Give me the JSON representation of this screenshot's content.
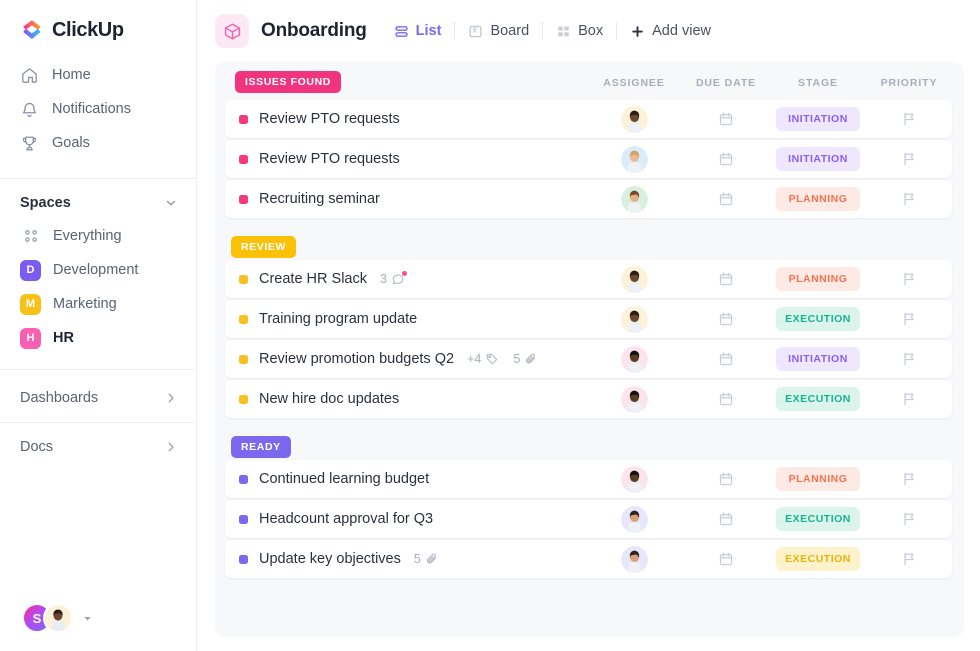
{
  "brand": {
    "name": "ClickUp"
  },
  "sidebar": {
    "nav": [
      {
        "label": "Home",
        "icon": "home-icon"
      },
      {
        "label": "Notifications",
        "icon": "bell-icon"
      },
      {
        "label": "Goals",
        "icon": "trophy-icon"
      }
    ],
    "spaces_title": "Spaces",
    "spaces": [
      {
        "label": "Everything",
        "icon": "grid-icon",
        "initial": "",
        "color": "",
        "active": false
      },
      {
        "label": "Development",
        "icon": "space-badge",
        "initial": "D",
        "color": "#7b5cf0",
        "active": false
      },
      {
        "label": "Marketing",
        "icon": "space-badge",
        "initial": "M",
        "color": "#f7c116",
        "active": false
      },
      {
        "label": "HR",
        "icon": "space-badge",
        "initial": "H",
        "color": "#f85fb0",
        "active": true
      }
    ],
    "links": [
      {
        "label": "Dashboards"
      },
      {
        "label": "Docs"
      }
    ],
    "footer": {
      "workspace_initial": "S"
    }
  },
  "header": {
    "title": "Onboarding",
    "views": [
      {
        "label": "List",
        "icon": "list-icon",
        "active": true
      },
      {
        "label": "Board",
        "icon": "board-icon",
        "active": false
      },
      {
        "label": "Box",
        "icon": "box-icon",
        "active": false
      },
      {
        "label": "Add view",
        "icon": "plus-icon",
        "active": false
      }
    ]
  },
  "columns": {
    "assignee": "ASSIGNEE",
    "due_date": "DUE DATE",
    "stage": "STAGE",
    "priority": "PRIORITY"
  },
  "groups": [
    {
      "badge": "ISSUES FOUND",
      "badge_bg": "#f0357e",
      "dot_color": "#f5397f",
      "tasks": [
        {
          "title": "Review PTO requests",
          "stage": "INITIATION",
          "stage_fg": "#8b5cf6",
          "stage_bg": "#efe7fe",
          "avatar_bg": "#fdf2d9",
          "avatar_skin": "#6b4630",
          "avatar_hair": "#2b1c14",
          "comments": "",
          "tags": "",
          "files": ""
        },
        {
          "title": "Review PTO requests",
          "stage": "INITIATION",
          "stage_fg": "#8b5cf6",
          "stage_bg": "#efe7fe",
          "avatar_bg": "#d9ecfb",
          "avatar_skin": "#e8bb94",
          "avatar_hair": "#d6a35a",
          "comments": "",
          "tags": "",
          "files": ""
        },
        {
          "title": "Recruiting seminar",
          "stage": "PLANNING",
          "stage_fg": "#f4734f",
          "stage_bg": "#fdeae4",
          "avatar_bg": "#d9f0de",
          "avatar_skin": "#e3b089",
          "avatar_hair": "#7b4a2c",
          "comments": "",
          "tags": "",
          "files": ""
        }
      ]
    },
    {
      "badge": "REVIEW",
      "badge_bg": "#fbc108",
      "dot_color": "#f9c023",
      "tasks": [
        {
          "title": "Create HR Slack",
          "stage": "PLANNING",
          "stage_fg": "#f4734f",
          "stage_bg": "#fdeae4",
          "avatar_bg": "#fdf2d9",
          "avatar_skin": "#6b4630",
          "avatar_hair": "#2b1c14",
          "comments": "3",
          "tags": "",
          "files": ""
        },
        {
          "title": "Training program update",
          "stage": "EXECUTION",
          "stage_fg": "#16b391",
          "stage_bg": "#dcf5ec",
          "avatar_bg": "#fdf2d9",
          "avatar_skin": "#6b4630",
          "avatar_hair": "#2b1c14",
          "comments": "",
          "tags": "",
          "files": ""
        },
        {
          "title": "Review promotion budgets Q2",
          "stage": "INITIATION",
          "stage_fg": "#8b5cf6",
          "stage_bg": "#efe7fe",
          "avatar_bg": "#fbe4ee",
          "avatar_skin": "#5c3a24",
          "avatar_hair": "#161213",
          "comments": "",
          "tags": "+4",
          "files": "5"
        },
        {
          "title": "New hire doc updates",
          "stage": "EXECUTION",
          "stage_fg": "#16b391",
          "stage_bg": "#dcf5ec",
          "avatar_bg": "#fbe4ee",
          "avatar_skin": "#5c3a24",
          "avatar_hair": "#161213",
          "comments": "",
          "tags": "",
          "files": ""
        }
      ]
    },
    {
      "badge": "READY",
      "badge_bg": "#7b68ee",
      "dot_color": "#7b68ee",
      "tasks": [
        {
          "title": "Continued learning budget",
          "stage": "PLANNING",
          "stage_fg": "#f4734f",
          "stage_bg": "#fdeae4",
          "avatar_bg": "#fbe4ee",
          "avatar_skin": "#5c3a24",
          "avatar_hair": "#161213",
          "comments": "",
          "tags": "",
          "files": ""
        },
        {
          "title": "Headcount approval for Q3",
          "stage": "EXECUTION",
          "stage_fg": "#16b391",
          "stage_bg": "#dcf5ec",
          "avatar_bg": "#e8e6fb",
          "avatar_skin": "#d9a179",
          "avatar_hair": "#2f2520",
          "comments": "",
          "tags": "",
          "files": ""
        },
        {
          "title": "Update key objectives",
          "stage": "EXECUTION",
          "stage_fg": "#eab308",
          "stage_bg": "#fcf3cd",
          "avatar_bg": "#e8e6fb",
          "avatar_skin": "#d9a179",
          "avatar_hair": "#2f2520",
          "comments": "",
          "tags": "",
          "files": "5"
        }
      ]
    }
  ]
}
